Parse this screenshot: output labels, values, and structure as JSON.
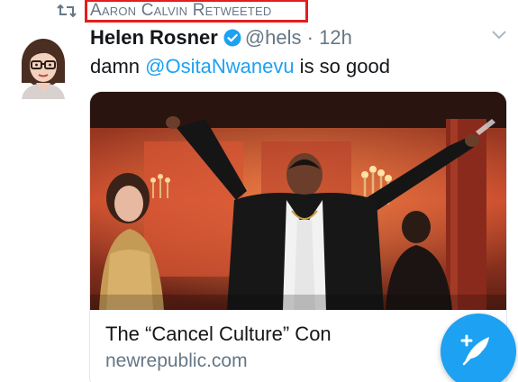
{
  "retweet": {
    "label": "Aaron Calvin Retweeted",
    "icon": "retweet-icon",
    "highlight_color": "#e41d1d"
  },
  "tweet": {
    "author_name": "Helen Rosner",
    "verified_icon": "verified-badge-icon",
    "handle": "@hels",
    "separator": "·",
    "time": "12h",
    "text_prefix": "damn ",
    "mention": "@OsitaNwanevu",
    "text_suffix": " is so good",
    "menu_icon": "chevron-down-icon"
  },
  "card": {
    "title": "The “Cancel Culture” Con",
    "domain": "newrepublic.com",
    "image": "card-photo"
  },
  "compose": {
    "icon": "compose-feather-icon"
  },
  "colors": {
    "accent": "#1da1f2",
    "primary_text": "#14171a",
    "secondary_text": "#657786"
  }
}
